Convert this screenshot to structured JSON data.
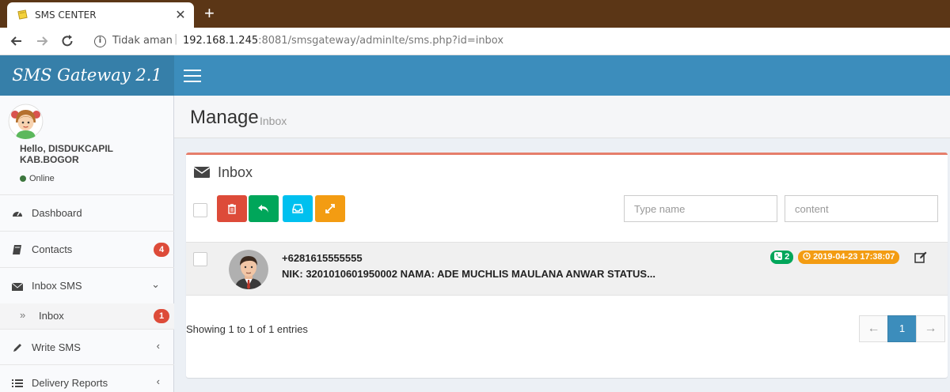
{
  "browser": {
    "tab_title": "SMS CENTER",
    "security_label": "Tidak aman",
    "url_host": "192.168.1.245",
    "url_rest": ":8081/smsgateway/adminlte/sms.php?id=inbox"
  },
  "sidebar": {
    "logo": "SMS Gateway 2.1",
    "user_greeting": "Hello, DISDUKCAPIL KAB.BOGOR",
    "status": "Online",
    "items": [
      {
        "label": "Dashboard",
        "icon": "dashboard-icon"
      },
      {
        "label": "Contacts",
        "badge": "4",
        "icon": "book-icon"
      },
      {
        "label": "Inbox SMS",
        "icon": "envelope-icon",
        "expanded": true
      },
      {
        "label": "Inbox",
        "badge": "1",
        "icon": "double-chevron-icon"
      },
      {
        "label": "Write SMS",
        "icon": "pencil-icon"
      },
      {
        "label": "Delivery Reports",
        "icon": "list-icon"
      }
    ]
  },
  "header": {
    "title": "Manage",
    "subtitle": "Inbox"
  },
  "box": {
    "title": "Inbox",
    "search_name_placeholder": "Type name",
    "search_content_placeholder": "content",
    "buttons": {
      "delete_color": "#dd4b39",
      "reply_color": "#00a65a",
      "inbox_color": "#00c0ef",
      "expand_color": "#f39c12"
    }
  },
  "messages": [
    {
      "sender": "+6281615555555",
      "text": "NIK: 3201010601950002 NAMA: ADE MUCHLIS MAULANA ANWAR STATUS...",
      "count": "2",
      "timestamp": "2019-04-23 17:38:07"
    }
  ],
  "footer": {
    "showing": "Showing 1 to 1 of 1 entries",
    "prev": "←",
    "page": "1",
    "next": "→"
  }
}
